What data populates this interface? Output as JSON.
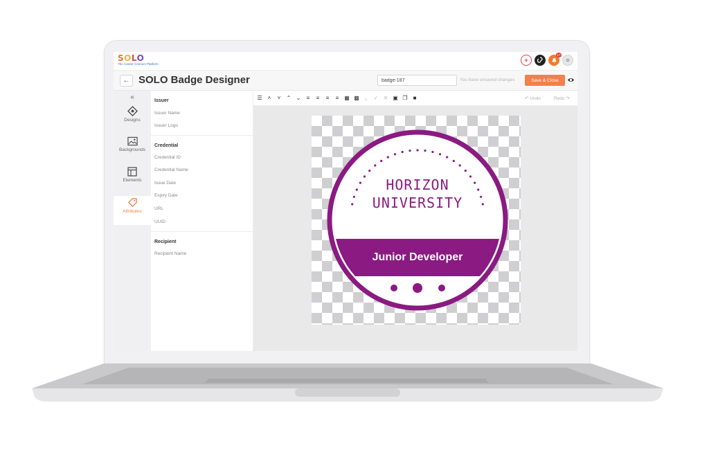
{
  "app": {
    "logo_text": "SOLO",
    "logo_tagline": "The Career Connect Platform",
    "notification_count": "17"
  },
  "titlebar": {
    "back_symbol": "←",
    "title": "SOLO Badge Designer",
    "badge_id_value": "badge-187",
    "unsaved_text": "You have unsaved changes",
    "save_label": "Save & Close"
  },
  "rail": {
    "collapse_symbol": "«",
    "items": [
      {
        "label": "Designs",
        "icon": "diamond-icon"
      },
      {
        "label": "Backgrounds",
        "icon": "image-icon"
      },
      {
        "label": "Elements",
        "icon": "layout-icon"
      },
      {
        "label": "Attributes",
        "icon": "tag-icon",
        "active": true
      }
    ]
  },
  "panel": {
    "issuer": {
      "heading": "Issuer",
      "items": [
        "Issuer Name",
        "Issuer Logo"
      ]
    },
    "credential": {
      "heading": "Credential",
      "items": [
        "Credential ID",
        "Credential Name",
        "Issue Date",
        "Expiry Date",
        "URL",
        "UUID"
      ]
    },
    "recipient": {
      "heading": "Recipient",
      "items": [
        "Recipient Name"
      ]
    }
  },
  "toolbar": {
    "undo_label": "Undo",
    "redo_label": "Redo"
  },
  "badge": {
    "line1": "HORIZON",
    "line2": "UNIVERSITY",
    "ribbon": "Junior Developer",
    "color": "#8b1a82"
  },
  "colors": {
    "accent": "#f3804a",
    "badge_purple": "#8b1a82"
  }
}
